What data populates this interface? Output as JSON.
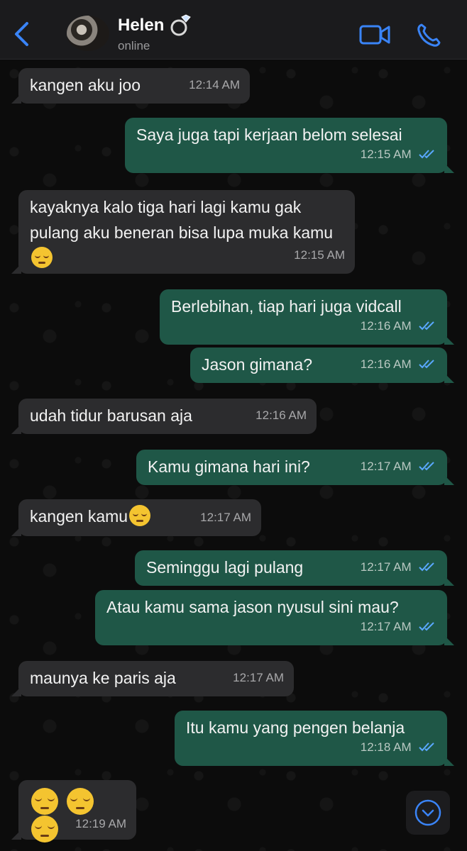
{
  "header": {
    "contact_name": "Helen",
    "contact_status": "online",
    "accent_color": "#3a84f7"
  },
  "messages": [
    {
      "dir": "in",
      "text": "kangen aku joo",
      "time": "12:14 AM"
    },
    {
      "dir": "out",
      "text": "Saya juga tapi kerjaan belom selesai",
      "time": "12:15 AM",
      "status": "read"
    },
    {
      "dir": "in",
      "text": "kayaknya kalo tiga hari lagi kamu gak pulang aku beneran bisa lupa muka kamu",
      "emoji": "pensive-face",
      "time": "12:15 AM"
    },
    {
      "dir": "out",
      "text": "Berlebihan, tiap hari juga vidcall",
      "time": "12:16 AM",
      "status": "read"
    },
    {
      "dir": "out",
      "text": "Jason gimana?",
      "time": "12:16 AM",
      "status": "read"
    },
    {
      "dir": "in",
      "text": "udah tidur barusan aja",
      "time": "12:16 AM"
    },
    {
      "dir": "out",
      "text": "Kamu gimana hari ini?",
      "time": "12:17 AM",
      "status": "read"
    },
    {
      "dir": "in",
      "text": "kangen kamu",
      "emoji": "pensive-face",
      "time": "12:17 AM"
    },
    {
      "dir": "out",
      "text": "Seminggu lagi pulang",
      "time": "12:17 AM",
      "status": "read"
    },
    {
      "dir": "out",
      "text": "Atau kamu sama jason nyusul sini mau?",
      "time": "12:17 AM",
      "status": "read"
    },
    {
      "dir": "in",
      "text": "maunya ke paris aja",
      "time": "12:17 AM"
    },
    {
      "dir": "out",
      "text": "Itu kamu yang pengen belanja",
      "time": "12:18 AM",
      "status": "read"
    },
    {
      "dir": "in",
      "text": "",
      "emoji": "pensive-face x3",
      "time": "12:19 AM"
    }
  ]
}
